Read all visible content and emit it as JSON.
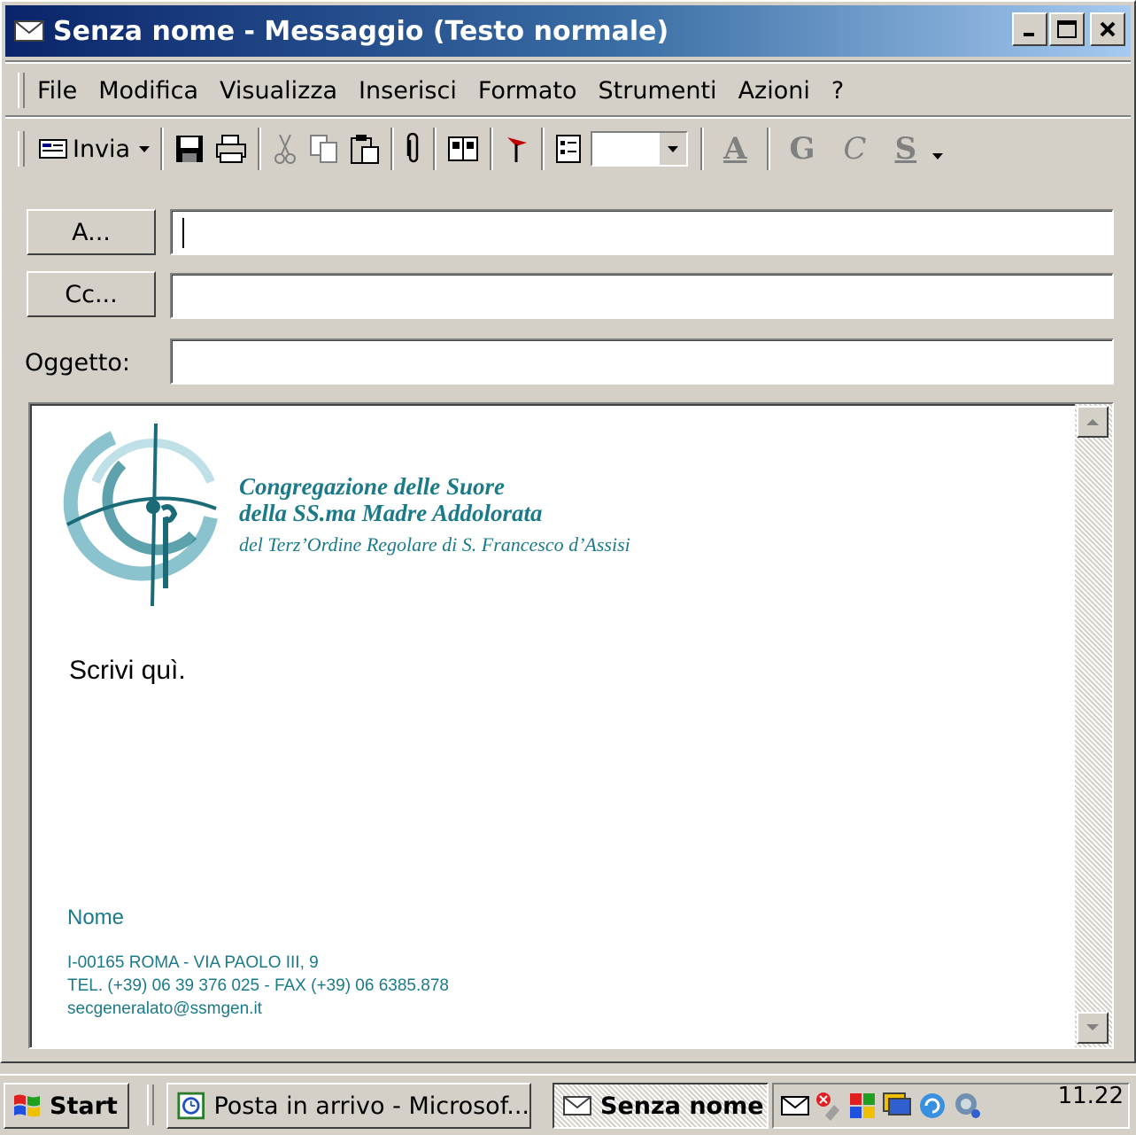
{
  "window": {
    "title": "Senza nome - Messaggio (Testo normale)",
    "controls": {
      "minimize": "_",
      "maximize": "□",
      "close": "X"
    }
  },
  "menu": {
    "items": [
      {
        "label": "File"
      },
      {
        "label": "Modifica"
      },
      {
        "label": "Visualizza"
      },
      {
        "label": "Inserisci"
      },
      {
        "label": "Formato"
      },
      {
        "label": "Strumenti"
      },
      {
        "label": "Azioni"
      },
      {
        "label": "?"
      }
    ]
  },
  "toolbar": {
    "send_label": "Invia",
    "format_letters": {
      "font_color": "A",
      "bold": "G",
      "italic": "C",
      "underline": "S"
    },
    "font_size_value": ""
  },
  "fields": {
    "to_button": "A...",
    "cc_button": "Cc...",
    "subject_label": "Oggetto:",
    "to_value": "",
    "cc_value": "",
    "subject_value": ""
  },
  "body": {
    "org_line1": "Congregazione delle Suore",
    "org_line2": "della SS.ma Madre Addolorata",
    "org_line3": "del Terz’Ordine Regolare di S. Francesco d’Assisi",
    "placeholder_text": "Scrivi quì.",
    "signature_name": "Nome",
    "signature_address": "I-00165 ROMA - VIA PAOLO III, 9",
    "signature_phone": "TEL. (+39) 06 39 376 025 - FAX (+39) 06 6385.878",
    "signature_email": "secgeneralato@ssmgen.it"
  },
  "colors": {
    "titlebar_start": "#0a246a",
    "titlebar_end": "#a6caf0",
    "brand_teal": "#1a7a8a"
  },
  "taskbar": {
    "start_label": "Start",
    "tasks": [
      {
        "label": "Posta in arrivo - Microsof..."
      },
      {
        "label": "Senza nome"
      }
    ],
    "clock": "11.22"
  }
}
